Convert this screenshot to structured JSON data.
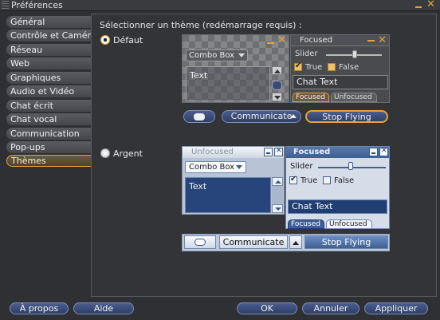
{
  "window": {
    "title": "Préférences"
  },
  "sidebar": {
    "items": [
      {
        "label": "Général"
      },
      {
        "label": "Contrôle et Camér"
      },
      {
        "label": "Réseau"
      },
      {
        "label": "Web"
      },
      {
        "label": "Graphiques"
      },
      {
        "label": "Audio et Vidéo"
      },
      {
        "label": "Chat écrit"
      },
      {
        "label": "Chat vocal"
      },
      {
        "label": "Communication"
      },
      {
        "label": "Pop-ups"
      },
      {
        "label": "Thèmes"
      }
    ],
    "selected": "Thèmes"
  },
  "themes": {
    "heading": "Sélectionner un thème (redémarrage requis) :",
    "default": {
      "label": "Défaut",
      "selected": true,
      "combo": "Combo Box",
      "text": "Text",
      "focused_title": "Focused",
      "slider": "Slider",
      "true_label": "True",
      "false_label": "False",
      "chat": "Chat Text",
      "tab_focused": "Focused",
      "tab_unfocused": "Unfocused",
      "communicate": "Communicate",
      "stop_flying": "Stop Flying"
    },
    "silver": {
      "label": "Argent",
      "selected": false,
      "unfocused_title": "Unfocused",
      "combo": "Combo Box",
      "text": "Text",
      "focused_title": "Focused",
      "slider": "Slider",
      "true_label": "True",
      "false_label": "False",
      "chat": "Chat Text",
      "tab_focused": "Focused",
      "tab_unfocused": "Unfocused",
      "communicate": "Communicate",
      "stop_flying": "Stop Flying"
    }
  },
  "footer": {
    "about": "À propos",
    "help": "Aide",
    "ok": "OK",
    "cancel": "Annuler",
    "apply": "Appliquer"
  },
  "colors": {
    "accent": "#e3a43c",
    "button": "#3a4c7a",
    "silver_focus": "#3e5f92"
  }
}
